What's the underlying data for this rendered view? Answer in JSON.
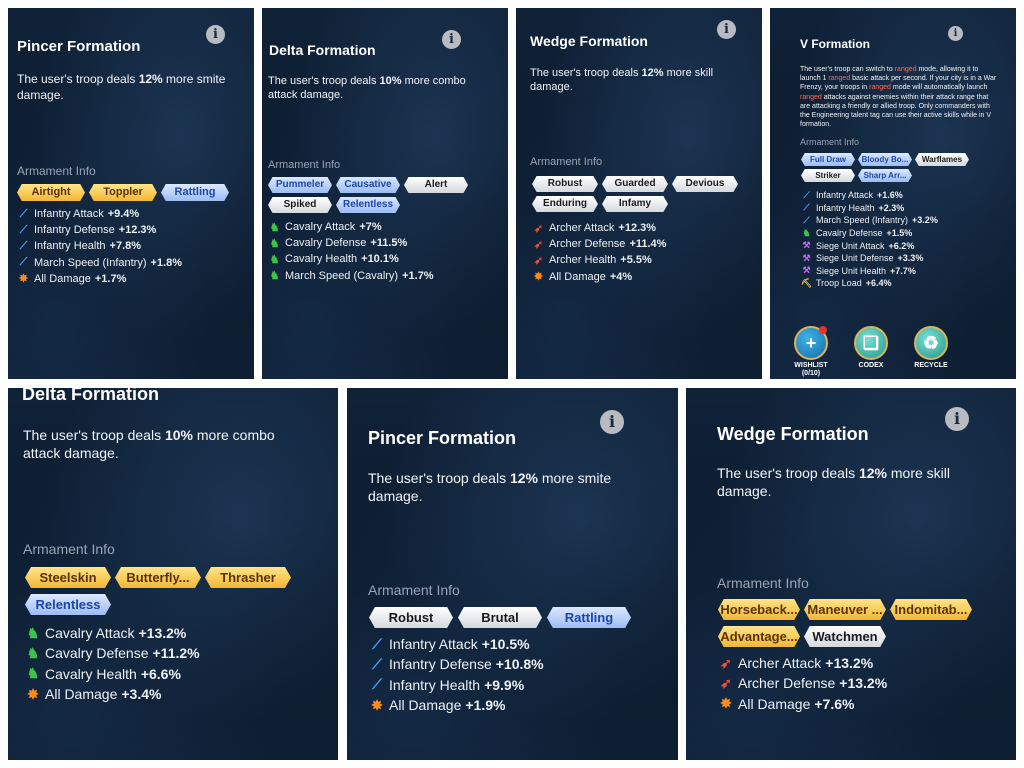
{
  "info_icon_glyph": "i",
  "panels": {
    "p1": {
      "title": "Pincer Formation",
      "desc": [
        "The user's troop deals ",
        "12%",
        " more smite damage."
      ],
      "armament_label": "Armament Info",
      "tags": [
        {
          "label": "Airtight",
          "color": "gold"
        },
        {
          "label": "Toppler",
          "color": "gold"
        },
        {
          "label": "Rattling",
          "color": "blue"
        }
      ],
      "stats": [
        {
          "icon": "infantry-icon",
          "label": "Infantry Attack",
          "value": "+9.4%"
        },
        {
          "icon": "infantry-icon",
          "label": "Infantry Defense",
          "value": "+12.3%"
        },
        {
          "icon": "infantry-icon",
          "label": "Infantry Health",
          "value": "+7.8%"
        },
        {
          "icon": "infantry-icon",
          "label": "March Speed (Infantry)",
          "value": "+1.8%"
        },
        {
          "icon": "all-damage-icon",
          "label": "All Damage",
          "value": "+1.7%"
        }
      ]
    },
    "p2": {
      "title": "Delta Formation",
      "desc": [
        "The user's troop deals ",
        "10%",
        " more combo attack damage."
      ],
      "armament_label": "Armament Info",
      "tags": [
        {
          "label": "Pummeler",
          "color": "blue"
        },
        {
          "label": "Causative",
          "color": "blue"
        },
        {
          "label": "Alert",
          "color": "white"
        },
        {
          "label": "Spiked",
          "color": "white"
        },
        {
          "label": "Relentless",
          "color": "blue"
        }
      ],
      "stats": [
        {
          "icon": "cavalry-icon",
          "label": "Cavalry Attack",
          "value": "+7%"
        },
        {
          "icon": "cavalry-icon",
          "label": "Cavalry Defense",
          "value": "+11.5%"
        },
        {
          "icon": "cavalry-icon",
          "label": "Cavalry Health",
          "value": "+10.1%"
        },
        {
          "icon": "cavalry-icon",
          "label": "March Speed (Cavalry)",
          "value": "+1.7%"
        }
      ]
    },
    "p3": {
      "title": "Wedge Formation",
      "desc": [
        "The user's troop deals ",
        "12%",
        " more skill damage."
      ],
      "armament_label": "Armament Info",
      "tags": [
        {
          "label": "Robust",
          "color": "white"
        },
        {
          "label": "Guarded",
          "color": "white"
        },
        {
          "label": "Devious",
          "color": "white"
        },
        {
          "label": "Enduring",
          "color": "white"
        },
        {
          "label": "Infamy",
          "color": "white"
        }
      ],
      "stats": [
        {
          "icon": "archer-icon",
          "label": "Archer Attack",
          "value": "+12.3%"
        },
        {
          "icon": "archer-icon",
          "label": "Archer Defense",
          "value": "+11.4%"
        },
        {
          "icon": "archer-icon",
          "label": "Archer Health",
          "value": "+5.5%"
        },
        {
          "icon": "all-damage-icon",
          "label": "All Damage",
          "value": "+4%"
        }
      ]
    },
    "p4": {
      "title": "V Formation",
      "desc_parts": [
        {
          "t": "The user's troop can switch to ",
          "red": false
        },
        {
          "t": "ranged",
          "red": true
        },
        {
          "t": " mode, allowing it to launch 1 ",
          "red": false
        },
        {
          "t": "ranged",
          "red": true
        },
        {
          "t": " basic attack per second. If your city is in a War Frenzy, your troops in ",
          "red": false
        },
        {
          "t": "ranged",
          "red": true
        },
        {
          "t": " mode will automatically launch ",
          "red": false
        },
        {
          "t": "ranged",
          "red": true
        },
        {
          "t": " attacks against enemies within their attack range that are attacking a friendly or allied troop. Only commanders with the Engineering talent tag can use their active skills while in V formation.",
          "red": false
        }
      ],
      "armament_label": "Armament Info",
      "tags": [
        {
          "label": "Full Draw",
          "color": "blue"
        },
        {
          "label": "Bloody Bo...",
          "color": "blue"
        },
        {
          "label": "Warflames",
          "color": "white"
        },
        {
          "label": "Striker",
          "color": "white"
        },
        {
          "label": "Sharp Arr...",
          "color": "blue"
        }
      ],
      "stats": [
        {
          "icon": "infantry-icon",
          "label": "Infantry Attack",
          "value": "+1.6%"
        },
        {
          "icon": "infantry-icon",
          "label": "Infantry Health",
          "value": "+2.3%"
        },
        {
          "icon": "infantry-icon",
          "label": "March Speed (Infantry)",
          "value": "+3.2%"
        },
        {
          "icon": "cavalry-icon",
          "label": "Cavalry Defense",
          "value": "+1.5%"
        },
        {
          "icon": "siege-icon",
          "label": "Siege Unit Attack",
          "value": "+6.2%"
        },
        {
          "icon": "siege-icon",
          "label": "Siege Unit Defense",
          "value": "+3.3%"
        },
        {
          "icon": "siege-icon",
          "label": "Siege Unit Health",
          "value": "+7.7%"
        },
        {
          "icon": "troop-load-icon",
          "label": "Troop Load",
          "value": "+6.4%"
        }
      ],
      "buttons": [
        {
          "label": "WISHLIST",
          "sub": "(0/10)",
          "icon": "plus-icon",
          "glyph": "+"
        },
        {
          "label": "CODEX",
          "sub": "",
          "icon": "book-icon",
          "glyph": "❑"
        },
        {
          "label": "RECYCLE",
          "sub": "",
          "icon": "recycle-icon",
          "glyph": "♻"
        }
      ]
    },
    "p5": {
      "title": "Delta Formation",
      "desc": [
        "The user's troop deals ",
        "10%",
        " more combo attack damage."
      ],
      "armament_label": "Armament Info",
      "tags": [
        {
          "label": "Steelskin",
          "color": "gold"
        },
        {
          "label": "Butterfly...",
          "color": "gold"
        },
        {
          "label": "Thrasher",
          "color": "gold"
        },
        {
          "label": "Relentless",
          "color": "blue"
        }
      ],
      "stats": [
        {
          "icon": "cavalry-icon",
          "label": "Cavalry Attack",
          "value": "+13.2%"
        },
        {
          "icon": "cavalry-icon",
          "label": "Cavalry Defense",
          "value": "+11.2%"
        },
        {
          "icon": "cavalry-icon",
          "label": "Cavalry Health",
          "value": "+6.6%"
        },
        {
          "icon": "all-damage-icon",
          "label": "All Damage",
          "value": "+3.4%"
        }
      ]
    },
    "p6": {
      "title": "Pincer Formation",
      "desc": [
        "The user's troop deals ",
        "12%",
        " more smite damage."
      ],
      "armament_label": "Armament Info",
      "tags": [
        {
          "label": "Robust",
          "color": "white"
        },
        {
          "label": "Brutal",
          "color": "white"
        },
        {
          "label": "Rattling",
          "color": "blue"
        }
      ],
      "stats": [
        {
          "icon": "infantry-icon",
          "label": "Infantry Attack",
          "value": "+10.5%"
        },
        {
          "icon": "infantry-icon",
          "label": "Infantry Defense",
          "value": "+10.8%"
        },
        {
          "icon": "infantry-icon",
          "label": "Infantry Health",
          "value": "+9.9%"
        },
        {
          "icon": "all-damage-icon",
          "label": "All Damage",
          "value": "+1.9%"
        }
      ]
    },
    "p7": {
      "title": "Wedge Formation",
      "desc": [
        "The user's troop deals ",
        "12%",
        " more skill damage."
      ],
      "armament_label": "Armament Info",
      "tags": [
        {
          "label": "Horseback...",
          "color": "gold"
        },
        {
          "label": "Maneuver ...",
          "color": "gold"
        },
        {
          "label": "Indomitab...",
          "color": "gold"
        },
        {
          "label": "Advantage...",
          "color": "gold"
        },
        {
          "label": "Watchmen",
          "color": "white"
        }
      ],
      "stats": [
        {
          "icon": "archer-icon",
          "label": "Archer Attack",
          "value": "+13.2%"
        },
        {
          "icon": "archer-icon",
          "label": "Archer Defense",
          "value": "+13.2%"
        },
        {
          "icon": "all-damage-icon",
          "label": "All Damage",
          "value": "+7.6%"
        }
      ]
    }
  }
}
